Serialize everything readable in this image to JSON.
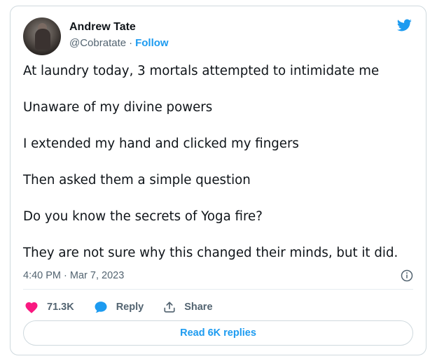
{
  "author": {
    "name": "Andrew Tate",
    "handle": "@Cobratate",
    "separator": "·",
    "follow_label": "Follow"
  },
  "tweet": {
    "lines": [
      "At laundry today, 3 mortals attempted to intimidate me",
      "Unaware of my divine powers",
      "I extended my hand and clicked my fingers",
      "Then asked them a simple question",
      "Do you know the secrets of Yoga fire?",
      "They are not sure why this changed their minds, but it did."
    ],
    "timestamp": "4:40 PM · Mar 7, 2023"
  },
  "actions": {
    "like_count": "71.3K",
    "reply_label": "Reply",
    "share_label": "Share"
  },
  "replies_button": "Read 6K replies",
  "colors": {
    "accent": "#1d9bf0",
    "like": "#f91880",
    "text": "#0f1419",
    "muted": "#536471"
  },
  "icons": [
    "twitter-bird-icon",
    "info-icon",
    "heart-icon",
    "reply-bubble-icon",
    "share-icon"
  ]
}
